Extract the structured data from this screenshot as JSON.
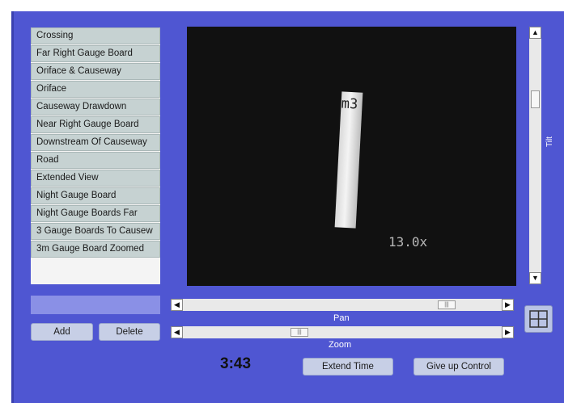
{
  "presets": [
    "Crossing",
    "Far Right Gauge Board",
    "Oriface & Causeway",
    "Oriface",
    "Causeway Drawdown",
    "Near Right Gauge Board",
    "Downstream Of Causeway",
    "Road",
    "Extended View",
    "Night Gauge Board",
    "Night Gauge Boards Far",
    "3 Gauge Boards To Causew",
    "3m Gauge Board Zoomed"
  ],
  "preset_name_input": {
    "value": "",
    "placeholder": ""
  },
  "buttons": {
    "add": "Add",
    "delete": "Delete",
    "extend_time": "Extend Time",
    "give_up_control": "Give up Control"
  },
  "video": {
    "board_text": "m3",
    "zoom_overlay": "13.0x"
  },
  "controls": {
    "pan_label": "Pan",
    "zoom_label": "Zoom",
    "tilt_label": "Tilt",
    "pan_level": 0.82,
    "zoom_level": 0.38,
    "tilt_level": 0.28
  },
  "timer": "3:43",
  "colors": {
    "panel": "#4f56d2",
    "preset_bg": "#c6d2d2",
    "button_bg": "#c7cfe6"
  },
  "icons": [
    "arrow-up-icon",
    "arrow-down-icon",
    "arrow-left-icon",
    "arrow-right-icon",
    "crosshair-icon"
  ]
}
